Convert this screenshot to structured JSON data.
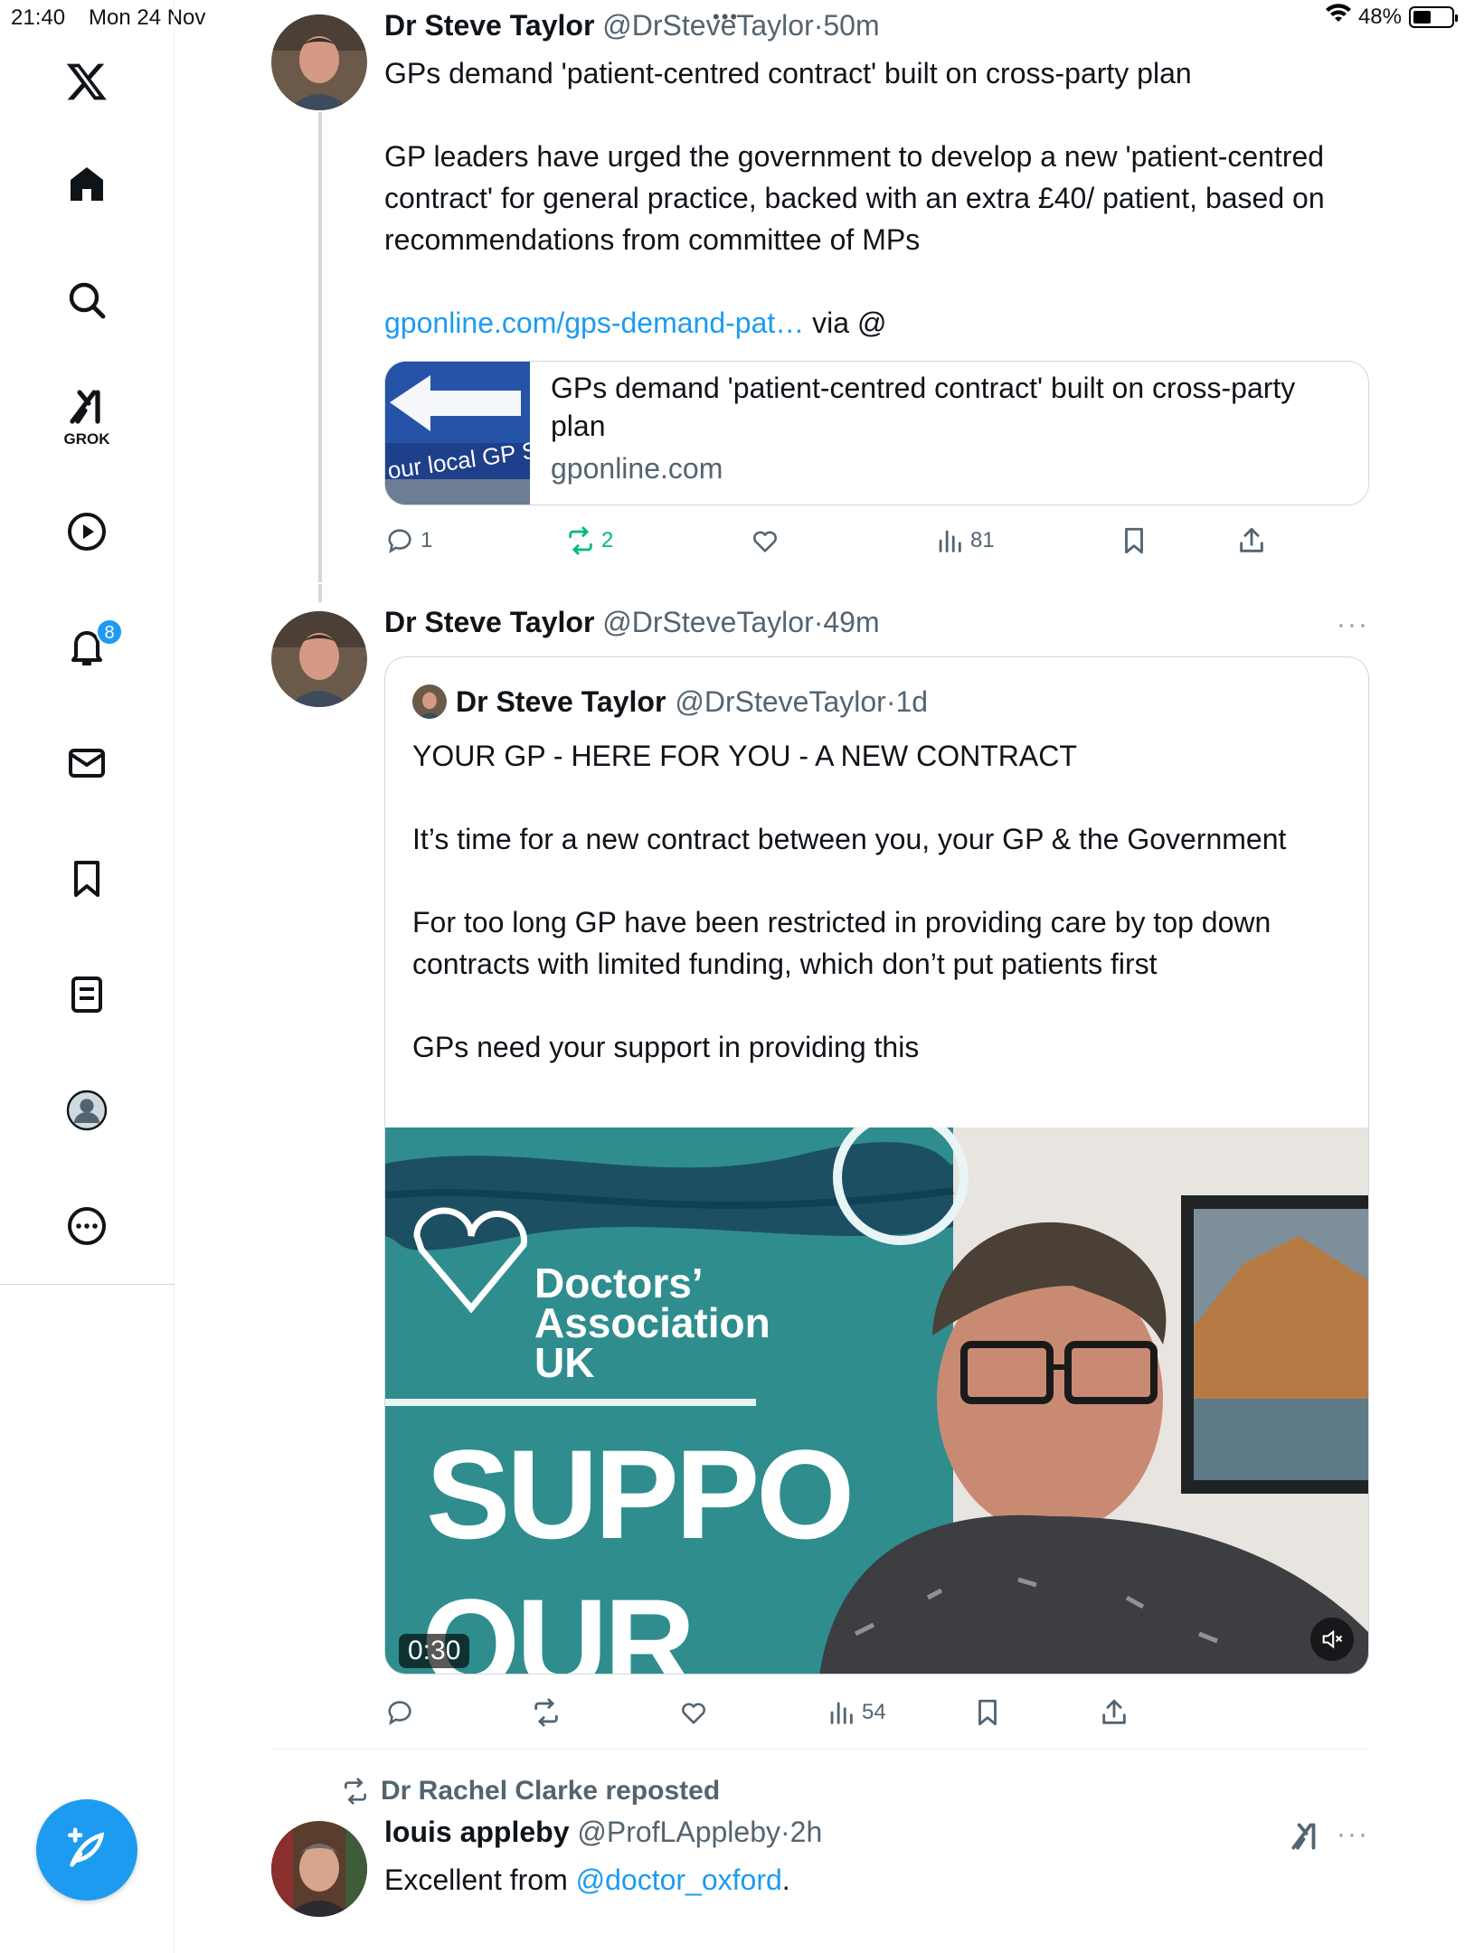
{
  "status_bar": {
    "time": "21:40",
    "date": "Mon 24 Nov",
    "battery": "48%",
    "battery_level": 0.48
  },
  "sidebar": {
    "grok_label": "GROK",
    "notification_count": "8",
    "items": [
      "x-logo",
      "home",
      "search",
      "grok",
      "videos",
      "notifications",
      "messages",
      "bookmarks",
      "lists",
      "profile",
      "more"
    ]
  },
  "tweet1": {
    "name": "Dr Steve Taylor",
    "handle": "@DrSteveTaylor",
    "sep": "·",
    "time": "50m",
    "text": "GPs demand 'patient-centred contract' built on cross-party plan\n\nGP leaders have urged the government to develop a new 'patient-centred contract' for general practice, backed with an extra £40/ patient, based on recommendations from committee of MPs",
    "link_text": "gponline.com/gps-demand-pat…",
    "via": " via @",
    "card": {
      "title": "GPs demand 'patient-centred contract' built on cross-party plan",
      "domain": "gponline.com",
      "thumb_text": "our local GP S"
    },
    "counts": {
      "replies": "1",
      "reposts": "2",
      "views": "81"
    }
  },
  "tweet2": {
    "name": "Dr Steve Taylor",
    "handle": "@DrSteveTaylor",
    "sep": "·",
    "time": "49m",
    "quote": {
      "name": "Dr Steve Taylor",
      "handle": "@DrSteveTaylor",
      "sep": "·",
      "time": "1d",
      "text": "YOUR GP - HERE FOR YOU - A NEW CONTRACT\n\nIt’s time for a new contract between you, your GP & the Government\n\nFor too long GP have been restricted in providing care by top down contracts with limited funding, which don’t put patients first\n\nGPs need your support in providing this",
      "video": {
        "banner_line1": "Doctors’",
        "banner_line2": "Association",
        "banner_line3": "UK",
        "banner_big": "SUPPO",
        "banner_big2": "OUR",
        "duration": "0:30"
      }
    },
    "counts": {
      "views": "54"
    }
  },
  "tweet3": {
    "repost_label": "Dr Rachel Clarke reposted",
    "name": "louis appleby",
    "handle": "@ProfLAppleby",
    "sep": "·",
    "time": "2h",
    "text_before": "Excellent from ",
    "mention": "@doctor_oxford",
    "text_after": "."
  },
  "colors": {
    "accent": "#1d9bf0",
    "repost_green": "#00ba7c",
    "muted": "#536471"
  }
}
